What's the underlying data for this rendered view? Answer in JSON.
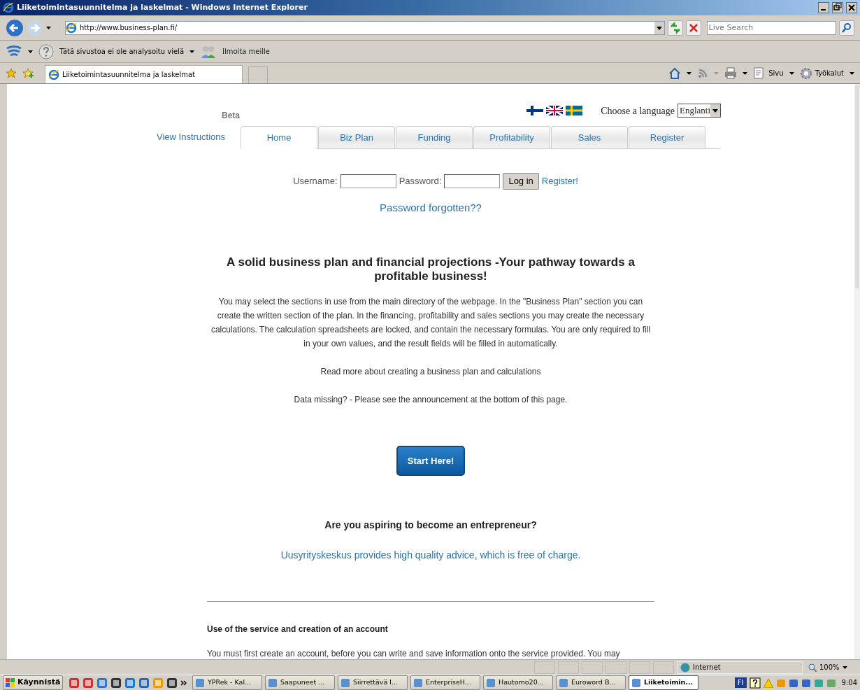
{
  "window": {
    "title": "Liiketoimintasuunnitelma ja laskelmat - Windows Internet Explorer"
  },
  "address": {
    "url": "http://www.business-plan.fi/"
  },
  "search": {
    "placeholder": "Live Search"
  },
  "links_bar": {
    "analysis": "Tätä sivustoa ei ole analysoitu vielä",
    "report": "Ilmoita meille"
  },
  "browser_tabs": [
    {
      "label": "Liiketoimintasuunnitelma ja laskelmat",
      "selected": true
    }
  ],
  "command_bar": [
    "Sivu",
    "Työkalut"
  ],
  "page": {
    "beta": "Beta",
    "language_label": "Choose a language",
    "language_value": "Englanti",
    "instructions_link": "View Instructions",
    "tabs": [
      {
        "label": "Home",
        "selected": true
      },
      {
        "label": "Biz Plan",
        "selected": false
      },
      {
        "label": "Funding",
        "selected": false
      },
      {
        "label": "Profitability",
        "selected": false
      },
      {
        "label": "Sales",
        "selected": false
      },
      {
        "label": "Register",
        "selected": false
      }
    ],
    "login": {
      "username_label": "Username:",
      "password_label": "Password:",
      "button": "Log in",
      "register_link": "Register!",
      "forgot_link": "Password forgotten??"
    },
    "headline": "A solid business plan and financial projections -Your pathway towards a profitable business!",
    "intro": "You may select the sections in use from the main directory of the webpage. In the \"Business Plan\" section you can create the written section of the plan. In the financing, profitability and sales sections you may create the necessary calculations. The calculation spreadsheets are locked, and contain the necessary formulas. You are only required to fill in your own values, and the result fields will be filled in automatically.",
    "read_more": "Read more about creating a business plan and calculations",
    "data_missing": "Data missing? - Please see the announcement at the bottom of this page.",
    "start_button": "Start Here!",
    "aspiring": "Are you aspiring to become an entrepreneur?",
    "advice_link": "Uusyrityskeskus provides high quality advice, which is free of charge.",
    "section_title": "Use of the service and creation of an account",
    "section_text": "You must first create an account, before you can write and save information onto the service provided. You may"
  },
  "status_bar": {
    "zone": "Internet",
    "zoom": "100%"
  },
  "taskbar": {
    "start": "Käynnistä",
    "tasks": [
      {
        "label": "YPRek - Kal...",
        "selected": false
      },
      {
        "label": "Saapuneet ...",
        "selected": false
      },
      {
        "label": "Siirrettävä l...",
        "selected": false
      },
      {
        "label": "EnterpriseH...",
        "selected": false
      },
      {
        "label": "Hautomo20...",
        "selected": false
      },
      {
        "label": "Euroword B...",
        "selected": false
      },
      {
        "label": "Liiketoimin...",
        "selected": true
      }
    ],
    "language": "FI",
    "clock": "9:04"
  }
}
